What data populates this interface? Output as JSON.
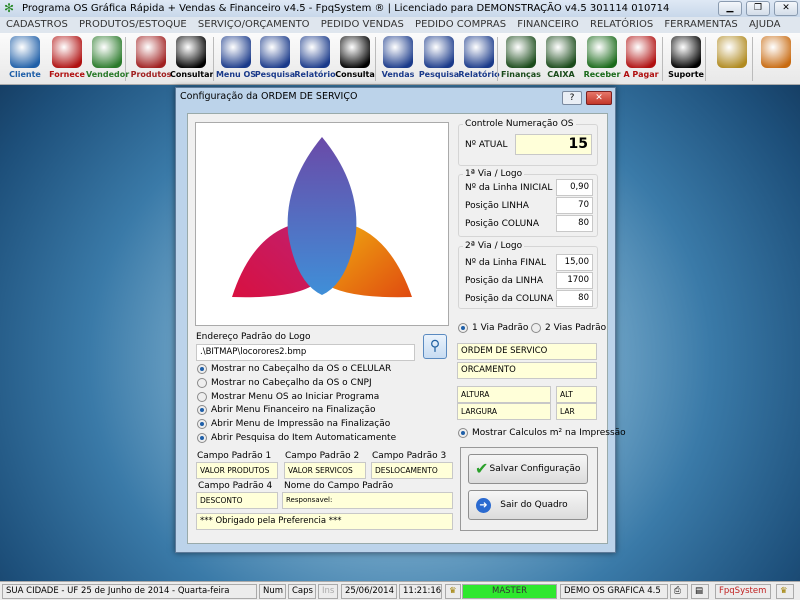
{
  "window": {
    "title": "Programa OS Gráfica Rápida + Vendas & Financeiro v4.5 - FpqSystem ® | Licenciado para  DEMONSTRAÇÃO v4.5 301114 010714"
  },
  "menu": [
    "CADASTROS",
    "PRODUTOS/ESTOQUE",
    "SERVIÇO/ORÇAMENTO",
    "PEDIDO VENDAS",
    "PEDIDO COMPRAS",
    "FINANCEIRO",
    "RELATÓRIOS",
    "FERRAMENTAS",
    "AJUDA"
  ],
  "toolbar": [
    {
      "label": "Cliente",
      "color": "#1f5fa8",
      "icon": "person-blue-icon"
    },
    {
      "label": "Fornece",
      "color": "#b01010",
      "icon": "person-red-icon"
    },
    {
      "label": "Vendedor",
      "color": "#2a7a2a",
      "icon": "person-green-icon"
    },
    {
      "label": "Produtos",
      "color": "#a02020",
      "icon": "boxes-icon"
    },
    {
      "label": "Consultar",
      "color": "#000000",
      "icon": "barcode-icon"
    },
    {
      "label": "Menu OS",
      "color": "#1a3a8a",
      "icon": "clipboard-icon"
    },
    {
      "label": "Pesquisa",
      "color": "#1a3a8a",
      "icon": "search-doc-icon"
    },
    {
      "label": "Relatório",
      "color": "#1a3a8a",
      "icon": "printer-icon"
    },
    {
      "label": "Consulta",
      "color": "#000000",
      "icon": "file-drawer-icon"
    },
    {
      "label": "Vendas",
      "color": "#1a3a8a",
      "icon": "monitor-icon"
    },
    {
      "label": "Pesquisa",
      "color": "#1a3a8a",
      "icon": "search-doc-icon"
    },
    {
      "label": "Relatório",
      "color": "#1a3a8a",
      "icon": "printer-icon"
    },
    {
      "label": "Finanças",
      "color": "#1a4a1a",
      "icon": "finance-chart-icon"
    },
    {
      "label": "CAIXA",
      "color": "#1a4a1a",
      "icon": "cash-book-icon"
    },
    {
      "label": "Receber",
      "color": "#1a6a1a",
      "icon": "dollar-green-icon"
    },
    {
      "label": "A Pagar",
      "color": "#b01010",
      "icon": "dollar-red-icon"
    },
    {
      "label": "Suporte",
      "color": "#000000",
      "icon": "support-icon"
    }
  ],
  "dialog": {
    "title": "Configuração da ORDEM DE SERVIÇO",
    "help": "?",
    "close": "✕",
    "controle": {
      "title": "Controle Numeração OS",
      "label": "Nº ATUAL",
      "value": "15"
    },
    "via1": {
      "title": "1ª Via / Logo",
      "rows": [
        {
          "label": "Nº da Linha INICIAL",
          "value": "0,90"
        },
        {
          "label": "Posição LINHA",
          "value": "70"
        },
        {
          "label": "Posição COLUNA",
          "value": "80"
        }
      ]
    },
    "via2": {
      "title": "2ª Via / Logo",
      "rows": [
        {
          "label": "Nº da Linha FINAL",
          "value": "15,00"
        },
        {
          "label": "Posição da LINHA",
          "value": "1700"
        },
        {
          "label": "Posição da COLUNA",
          "value": "80"
        }
      ]
    },
    "logo": {
      "label": "Endereço Padrão do Logo",
      "value": ".\\BITMAP\\locorores2.bmp"
    },
    "options": [
      {
        "label": "Mostrar no Cabeçalho da OS o CELULAR",
        "checked": true
      },
      {
        "label": "Mostrar no Cabeçalho da OS o CNPJ",
        "checked": false
      },
      {
        "label": "Mostrar Menu OS ao Iniciar Programa",
        "checked": false
      },
      {
        "label": "Abrir Menu Financeiro na Finalização",
        "checked": true
      },
      {
        "label": "Abrir Menu de Impressão na Finalização",
        "checked": true
      },
      {
        "label": "Abrir Pesquisa do Item Automaticamente",
        "checked": true
      }
    ],
    "campos": [
      {
        "label": "Campo Padrão 1",
        "value": "VALOR PRODUTOS"
      },
      {
        "label": "Campo Padrão 2",
        "value": "VALOR SERVICOS"
      },
      {
        "label": "Campo Padrão 3",
        "value": "DESLOCAMENTO"
      },
      {
        "label": "Campo Padrão 4",
        "value": "DESCONTO"
      },
      {
        "label": "Nome do Campo Padrão",
        "value": "Responsavel:"
      }
    ],
    "footer_msg": "*** Obrigado pela Preferencia ***",
    "via_radio": [
      {
        "label": "1 Via Padrão",
        "checked": true
      },
      {
        "label": "2 Vias Padrão",
        "checked": false
      }
    ],
    "titulo_os": "ORDEM DE SERVICO",
    "titulo_orc": "ORCAMENTO",
    "altura": "ALTURA",
    "alt": "ALT",
    "largura": "LARGURA",
    "lar": "LAR",
    "calc": {
      "label": "Mostrar Calculos m² na Impressão",
      "checked": true
    },
    "save": "Salvar Configuração",
    "exit": "Sair do Quadro"
  },
  "status": {
    "city": "SUA CIDADE - UF 25 de Junho de 2014 - Quarta-feira",
    "num": "Num",
    "caps": "Caps",
    "ins": "Ins",
    "date": "25/06/2014",
    "time": "11:21:16",
    "user": "MASTER",
    "company": "DEMO OS GRAFICA 4.5",
    "brand": "FpqSystem"
  }
}
